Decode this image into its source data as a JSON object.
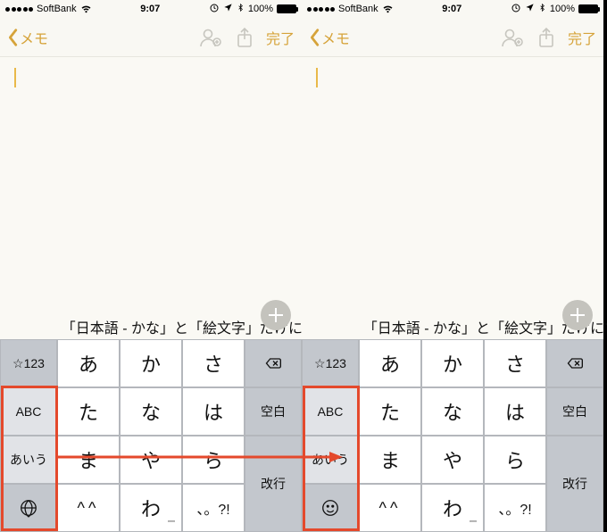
{
  "status": {
    "carrier": "SoftBank",
    "time": "9:07",
    "battery": "100%"
  },
  "nav": {
    "back": "メモ",
    "done": "完了"
  },
  "caption": "「日本語 - かな」と「絵文字」だけにするとキーボードの切り替えが便利。",
  "keyboard": {
    "r1c1": "☆123",
    "r1c2": "あ",
    "r1c3": "か",
    "r1c4": "さ",
    "r2c1": "ABC",
    "r2c2": "た",
    "r2c3": "な",
    "r2c4": "は",
    "r2c5": "空白",
    "r3c1": "あいう",
    "r3c2": "ま",
    "r3c3": "や",
    "r3c4": "ら",
    "r3c5": "改行",
    "r4c2a": "^",
    "r4c2b": "^",
    "r4c3": "わ",
    "r4c4": "、。?!",
    "waSub": "ー"
  },
  "icons": {
    "globe": "globe-icon",
    "emoji": "emoji-icon"
  }
}
